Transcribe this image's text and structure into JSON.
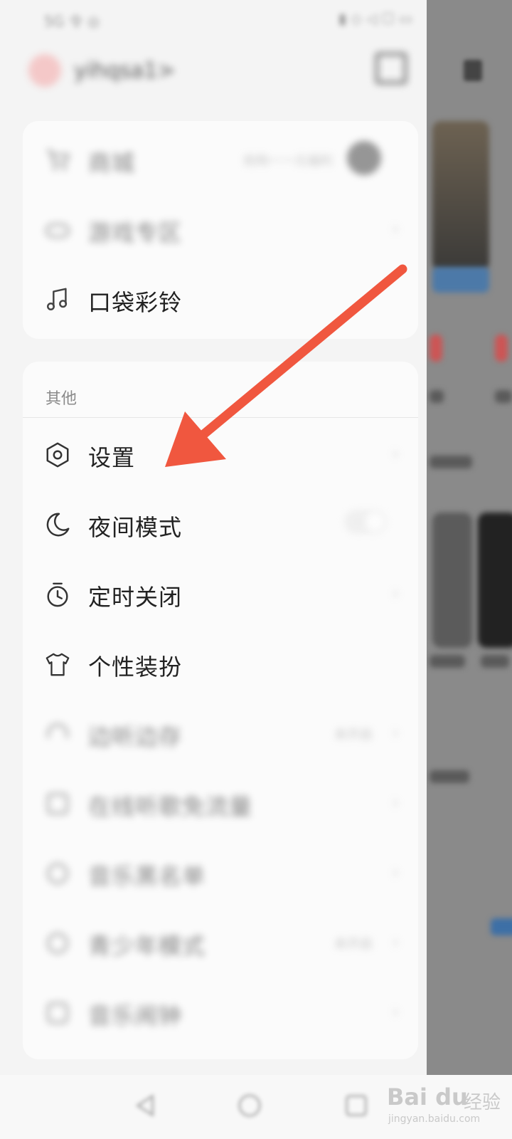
{
  "status_bar": {
    "left": "5G 令 ◎",
    "right": "▮ ◇ ◁ ☐ ▭"
  },
  "header": {
    "username": "yihqsa1>",
    "scan_icon": "scan-icon"
  },
  "menu_top": [
    {
      "label": "商城",
      "icon": "cart-icon",
      "meta": "抢购一一元福利",
      "blurred": true,
      "extra": "avatar"
    },
    {
      "label": "游戏专区",
      "icon": "gamepad-icon",
      "meta": "",
      "blurred": true,
      "extra": "chevron"
    },
    {
      "label": "口袋彩铃",
      "icon": "music-note-icon",
      "meta": "",
      "blurred": false,
      "extra": ""
    }
  ],
  "section_other": {
    "title": "其他",
    "items": [
      {
        "label": "设置",
        "icon": "settings-hexagon-icon",
        "meta": "",
        "blurred": false,
        "extra": "chevron"
      },
      {
        "label": "夜间模式",
        "icon": "moon-icon",
        "meta": "",
        "blurred": false,
        "extra": "toggle"
      },
      {
        "label": "定时关闭",
        "icon": "timer-icon",
        "meta": "",
        "blurred": false,
        "extra": "chevron"
      },
      {
        "label": "个性装扮",
        "icon": "tshirt-icon",
        "meta": "",
        "blurred": false,
        "extra": ""
      },
      {
        "label": "边听边存",
        "icon": "headphone-icon",
        "meta": "未开启",
        "blurred": true,
        "extra": "chevron"
      },
      {
        "label": "在线听歌免流量",
        "icon": "data-icon",
        "meta": "",
        "blurred": true,
        "extra": "chevron"
      },
      {
        "label": "音乐黑名单",
        "icon": "block-icon",
        "meta": "",
        "blurred": true,
        "extra": "chevron"
      },
      {
        "label": "青少年模式",
        "icon": "teen-icon",
        "meta": "未开启",
        "blurred": true,
        "extra": "chevron"
      },
      {
        "label": "音乐闹钟",
        "icon": "alarm-icon",
        "meta": "",
        "blurred": true,
        "extra": "chevron"
      }
    ]
  },
  "watermark": {
    "logo": "Bai du",
    "text": "经验",
    "url": "jingyan.baidu.com"
  },
  "colors": {
    "arrow": "#f0573f",
    "text": "#222222",
    "card": "#fbfbfb",
    "background": "#f4f4f4"
  }
}
